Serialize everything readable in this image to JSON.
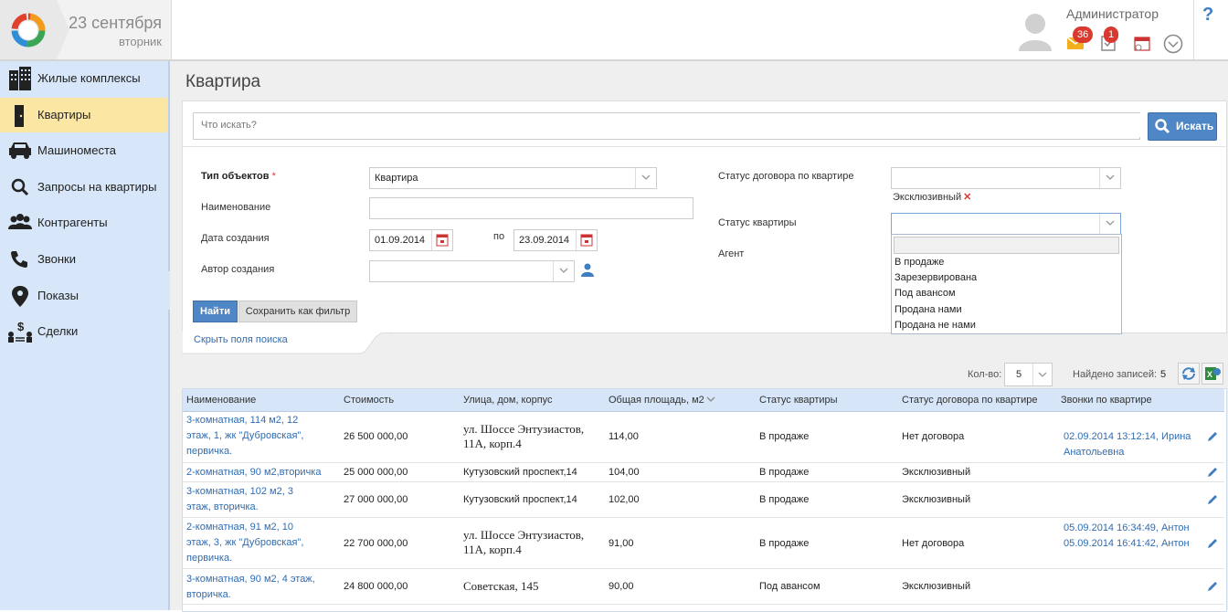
{
  "header": {
    "date": "23 сентября",
    "weekday": "вторник",
    "user_name": "Администратор",
    "mail_count": "36",
    "tasks_count": "1",
    "help": "?"
  },
  "sidebar": {
    "items": [
      {
        "label": "Жилые комплексы",
        "icon": "building-icon"
      },
      {
        "label": "Квартиры",
        "icon": "door-icon",
        "active": true
      },
      {
        "label": "Машиноместа",
        "icon": "car-icon"
      },
      {
        "label": "Запросы на квартиры",
        "icon": "search-icon"
      },
      {
        "label": "Контрагенты",
        "icon": "people-icon"
      },
      {
        "label": "Звонки",
        "icon": "phone-icon"
      },
      {
        "label": "Показы",
        "icon": "map-pin-icon"
      },
      {
        "label": "Сделки",
        "icon": "deal-icon"
      }
    ]
  },
  "page": {
    "title": "Квартира"
  },
  "search": {
    "placeholder": "Что искать?",
    "button": "Искать"
  },
  "filters": {
    "object_type_label": "Тип объектов",
    "object_type_required": "*",
    "object_type_value": "Квартира",
    "name_label": "Наименование",
    "created_label": "Дата создания",
    "created_from": "01.09.2014",
    "created_to_label": "по",
    "created_to": "23.09.2014",
    "author_label": "Автор создания",
    "contract_status_label": "Статус договора по квартире",
    "contract_status_tag": "Эксклюзивный",
    "apartment_status_label": "Статус квартиры",
    "agent_label": "Агент",
    "status_options": [
      "В продаже",
      "Зарезервирована",
      "Под авансом",
      "Продана нами",
      "Продана не нами"
    ],
    "find_button": "Найти",
    "save_filter_button": "Сохранить как фильтр",
    "hide_fields_link": "Скрыть поля поиска"
  },
  "results": {
    "qty_label": "Кол-во:",
    "qty_value": "5",
    "found_label": "Найдено записей:",
    "found_count": "5"
  },
  "table": {
    "columns": [
      "Наименование",
      "Стоимость",
      "Улица, дом, корпус",
      "Общая площадь, м2",
      "Статус квартиры",
      "Статус договора по квартире",
      "Звонки по квартире"
    ],
    "rows": [
      {
        "name": "3-комнатная, 114 м2, 12 этаж, 1, жк \"Дубровская\", первичка.",
        "price": "26 500 000,00",
        "address": "ул. Шоссе Энтузиастов, 11А, корп.4",
        "area": "114,00",
        "status": "В продаже",
        "contract": "Нет договора",
        "calls": [
          "02.09.2014 13:12:14, Ирина Анатольевна"
        ]
      },
      {
        "name": "2-комнатная, 90 м2,вторичка",
        "price": "25 000 000,00",
        "address": "Кутузовский проспект,14",
        "area": "104,00",
        "status": "В продаже",
        "contract": "Эксклюзивный",
        "calls": []
      },
      {
        "name": "3-комнатная, 102 м2, 3 этаж, вторичка.",
        "price": "27 000 000,00",
        "address": "Кутузовский проспект,14",
        "area": "102,00",
        "status": "В продаже",
        "contract": "Эксклюзивный",
        "calls": []
      },
      {
        "name": "2-комнатная, 91 м2, 10 этаж, 3, жк \"Дубровская\", первичка.",
        "price": "22 700 000,00",
        "address": "ул. Шоссе Энтузиастов, 11А, корп.4",
        "area": "91,00",
        "status": "В продаже",
        "contract": "Нет договора",
        "calls": [
          "05.09.2014 16:34:49, Антон",
          "05.09.2014 16:41:42, Антон"
        ]
      },
      {
        "name": "3-комнатная, 90 м2, 4 этаж, вторичка.",
        "price": "24 800 000,00",
        "address": "Советская, 145",
        "area": "90,00",
        "status": "Под авансом",
        "contract": "Эксклюзивный",
        "calls": []
      }
    ]
  }
}
